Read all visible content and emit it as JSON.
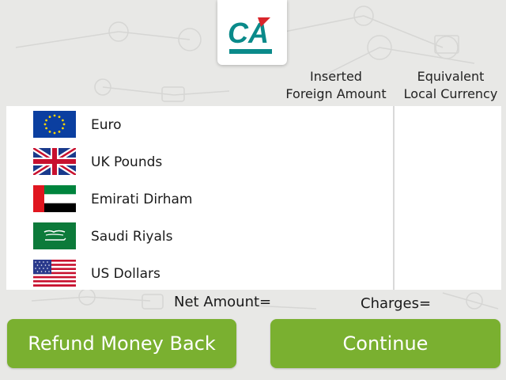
{
  "header": {
    "logo_text": "CA",
    "inserted_heading": "Inserted",
    "inserted_heading_2": "Foreign Amount",
    "equivalent_heading": "Equivalent",
    "equivalent_heading_2": "Local Currency"
  },
  "currencies": [
    {
      "name": "Euro",
      "flag": "eu-flag-icon"
    },
    {
      "name": "UK Pounds",
      "flag": "uk-flag-icon"
    },
    {
      "name": "Emirati Dirham",
      "flag": "uae-flag-icon"
    },
    {
      "name": "Saudi Riyals",
      "flag": "saudi-flag-icon"
    },
    {
      "name": "US Dollars",
      "flag": "us-flag-icon"
    }
  ],
  "summary": {
    "net_amount_label": "Net Amount=",
    "charges_label": "Charges="
  },
  "buttons": {
    "refund_label": "Refund Money Back",
    "continue_label": "Continue"
  },
  "colors": {
    "button_green": "#7ab030",
    "logo_teal": "#0a8a8a",
    "logo_red": "#d9252b",
    "background": "#e8e8e6"
  }
}
